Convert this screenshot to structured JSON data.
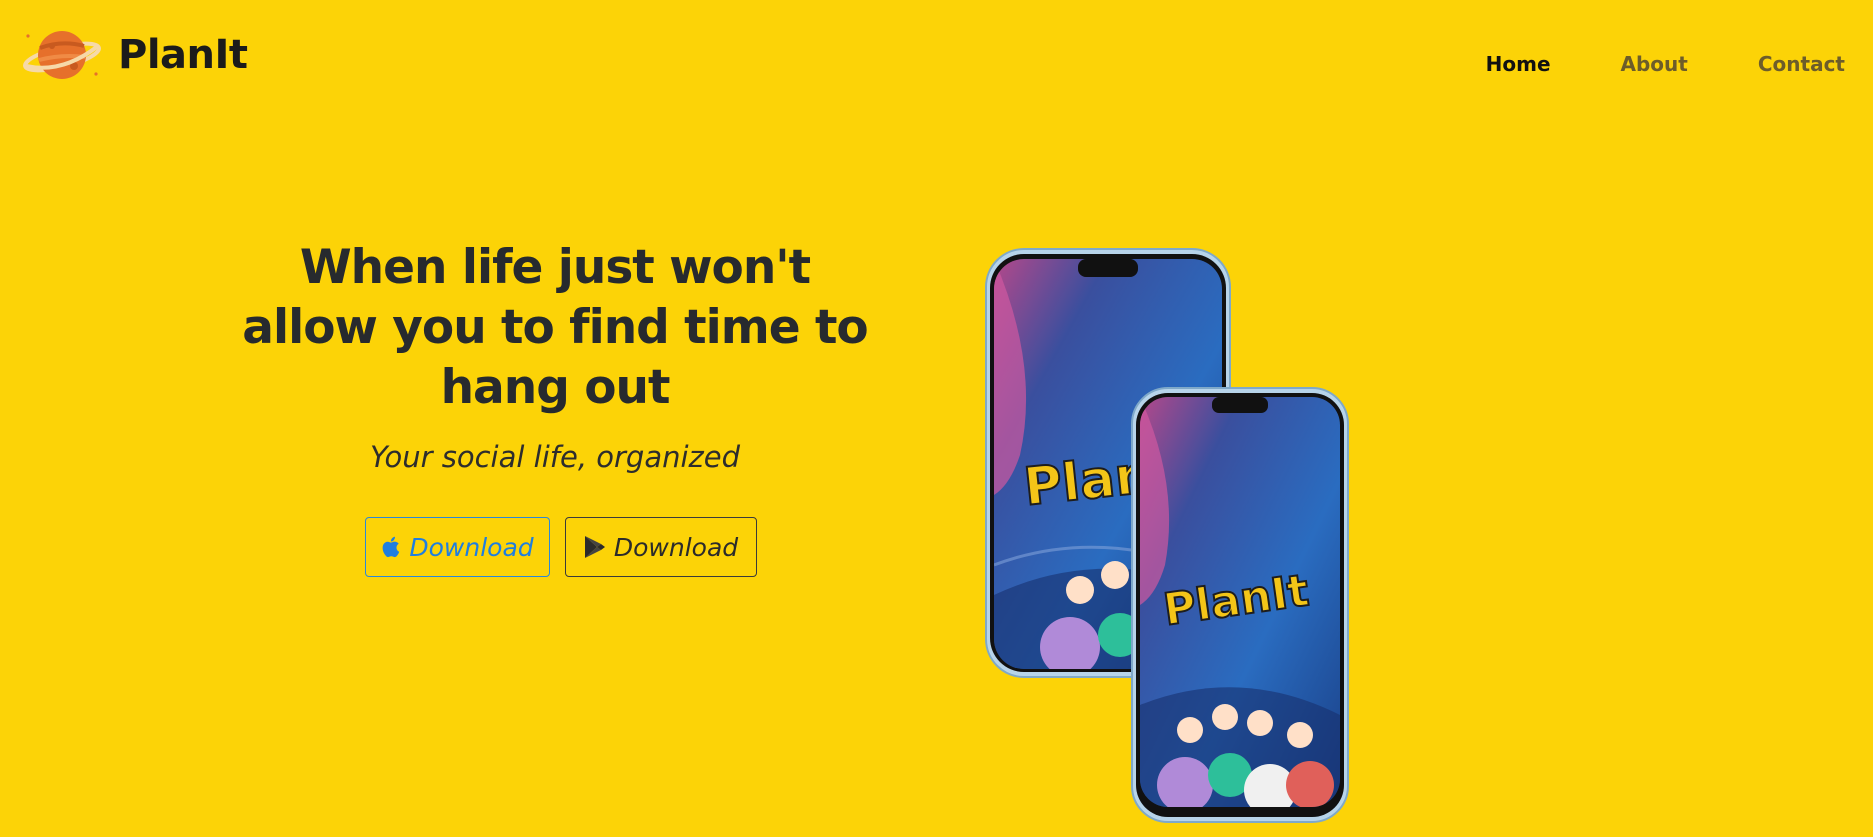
{
  "brand": {
    "name": "PlanIt",
    "logo_icon": "planet-icon"
  },
  "nav": {
    "items": [
      {
        "label": "Home",
        "active": true
      },
      {
        "label": "About",
        "active": false
      },
      {
        "label": "Contact",
        "active": false
      }
    ]
  },
  "hero": {
    "headline_lines": [
      "When life just won't",
      "allow you to find time to",
      "hang out"
    ],
    "subtitle": "Your social life, organized",
    "buttons": [
      {
        "label": "Download",
        "icon": "apple-icon",
        "color": "#1f7ee0"
      },
      {
        "label": "Download",
        "icon": "google-play-icon",
        "color": "#2b2b2b"
      }
    ],
    "phone_screen_text": "PlanIt",
    "phone_back_screen_text": "Plan"
  },
  "colors": {
    "background": "#FCD307",
    "text_dark": "#272a2e",
    "nav_inactive": "#6d5d2a",
    "apple_button": "#1f7ee0"
  }
}
